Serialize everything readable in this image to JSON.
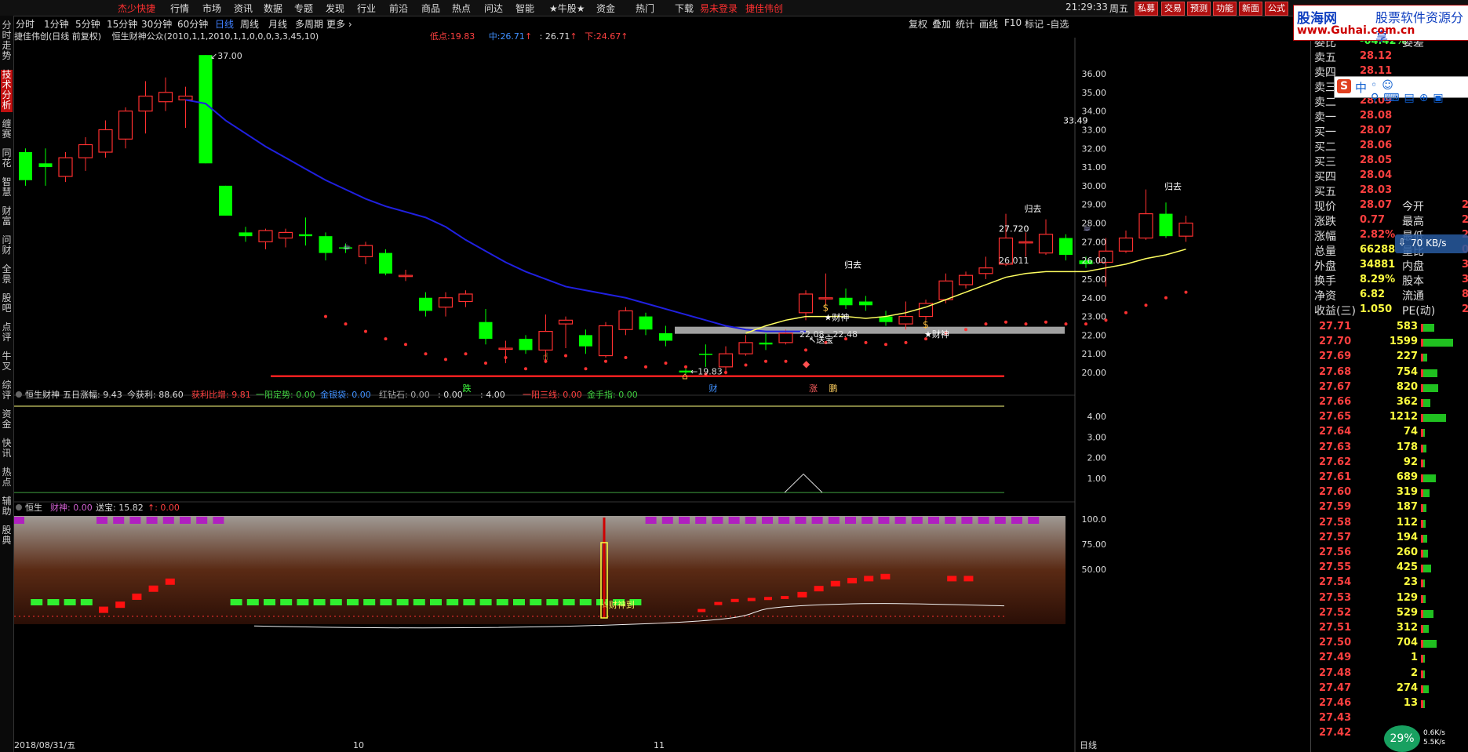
{
  "topbar": {
    "menus": [
      "分时",
      "1分钟",
      "5分钟",
      "15分钟",
      "30分钟",
      "60分钟"
    ],
    "app_name": "杰少快捷",
    "main_menus": [
      "行情",
      "市场",
      "资讯",
      "数据",
      "专题",
      "发现",
      "行业",
      "前沿",
      "商品",
      "热点",
      "问达",
      "智能",
      "★牛股★",
      "资金",
      "热门",
      "下载"
    ],
    "login_status": "易未登录",
    "stock_tag": "捷佳伟创",
    "time": "21:29:33",
    "weekday": "周五",
    "buttons": [
      "私募",
      "交易",
      "预测",
      "功能",
      "新面",
      "公式"
    ]
  },
  "left_tabs": [
    {
      "label": "分时走势",
      "active": false
    },
    {
      "label": "技术分析",
      "active": true
    },
    {
      "label": "缠赛",
      "active": false
    },
    {
      "label": "同花",
      "active": false
    },
    {
      "label": "智慧",
      "active": false
    },
    {
      "label": "财富",
      "active": false
    },
    {
      "label": "问财",
      "active": false
    },
    {
      "label": "全景",
      "active": false
    },
    {
      "label": "股吧",
      "active": false
    },
    {
      "label": "点评",
      "active": false
    },
    {
      "label": "牛叉",
      "active": false
    },
    {
      "label": "综评",
      "active": false
    },
    {
      "label": "资金",
      "active": false
    },
    {
      "label": "快讯",
      "active": false
    },
    {
      "label": "热点",
      "active": false
    },
    {
      "label": "辅助",
      "active": false
    },
    {
      "label": "股典",
      "active": false
    }
  ],
  "period_bar": {
    "periods": [
      "分时",
      "1分钟",
      "5分钟",
      "15分钟",
      "30分钟",
      "60分钟",
      "日线",
      "周线",
      "月线",
      "多周期",
      "更多"
    ],
    "active": "日线",
    "right_tools": [
      "复权",
      "叠加",
      "统计",
      "画线",
      "F10",
      "标记",
      "-自选"
    ]
  },
  "chart_info": {
    "title": "捷佳伟创(日线 前复权)",
    "formula": "恒生财神公众(2010,1,1,2010,1,1,0,0,0,3,3,45,10)",
    "low_label": "低点:",
    "low_value": "19.83",
    "mid_label": "中:",
    "mid_value": "26.71",
    "mid2": ": 26.71",
    "down_label": "下:",
    "down_value": "24.67"
  },
  "main_chart_labels": {
    "max_price": "37.00",
    "min_price": "19.83",
    "range_text": "22.08 - 22.48",
    "right_val1": "27.720",
    "right_val2": "26.011",
    "crosshair_val": "33.49",
    "guiqu": "归去",
    "caishen": "财神",
    "caishen_star": "★财神",
    "songbao": "送宝",
    "die": "跌",
    "cai": "财",
    "zhang": "涨",
    "peng": "鹏"
  },
  "indicator1": {
    "name": "恒生财神",
    "items": [
      "五日涨幅: 9.43",
      "今获利: 88.60",
      "获利比增: 9.81",
      "一阳定势: 0.00",
      "金银袋: 0.00",
      "红钻石: 0.00",
      ": 0.00",
      ": 4.00",
      "一阳三线: 0.00",
      "金手指: 0.00"
    ],
    "item_colors": [
      "#ddd",
      "#ddd",
      "#ff4040",
      "#40d040",
      "#4090ff",
      "#aaa",
      "#ddd",
      "#ddd",
      "#ff4040",
      "#40d040"
    ]
  },
  "indicator2": {
    "name": "恒生",
    "caishen": "财神: 0.00",
    "songbao": "送宝: 15.82",
    "extra": ": 0.00",
    "caishen_dao": "☆财神到"
  },
  "x_axis": {
    "start_date": "2018/08/31/五",
    "ticks": [
      "10",
      "11"
    ],
    "period_label": "日线"
  },
  "chart_data": {
    "type": "candlestick",
    "y_ticks": [
      "36.00",
      "35.00",
      "34.00",
      "33.00",
      "32.00",
      "31.00",
      "30.00",
      "29.00",
      "28.00",
      "27.00",
      "26.00",
      "25.00",
      "24.00",
      "23.00",
      "22.00",
      "21.00",
      "20.00"
    ],
    "ind1_ticks": [
      "4.00",
      "3.00",
      "2.00",
      "1.00"
    ],
    "ind2_ticks": [
      "100.0",
      "75.00",
      "50.00"
    ],
    "candles": [
      {
        "o": 30.3,
        "c": 31.8,
        "h": 32.0,
        "l": 30.0,
        "up": false
      },
      {
        "o": 31.0,
        "c": 31.2,
        "h": 32.0,
        "l": 30.0,
        "up": false
      },
      {
        "o": 30.5,
        "c": 31.5,
        "h": 31.8,
        "l": 30.2,
        "up": true
      },
      {
        "o": 31.5,
        "c": 32.2,
        "h": 32.6,
        "l": 30.8,
        "up": true
      },
      {
        "o": 31.8,
        "c": 33.0,
        "h": 33.5,
        "l": 31.5,
        "up": true
      },
      {
        "o": 32.5,
        "c": 34.0,
        "h": 34.2,
        "l": 32.0,
        "up": true
      },
      {
        "o": 34.0,
        "c": 34.8,
        "h": 35.6,
        "l": 32.8,
        "up": true
      },
      {
        "o": 34.5,
        "c": 35.0,
        "h": 35.8,
        "l": 34.0,
        "up": true
      },
      {
        "o": 34.6,
        "c": 34.8,
        "h": 35.3,
        "l": 33.1,
        "up": true
      },
      {
        "o": 37.0,
        "c": 31.2,
        "h": 37.0,
        "l": 31.2,
        "up": false
      },
      {
        "o": 30.0,
        "c": 28.4,
        "h": 30.0,
        "l": 28.4,
        "up": false
      },
      {
        "o": 27.3,
        "c": 27.5,
        "h": 27.8,
        "l": 27.0,
        "up": false
      },
      {
        "o": 27.0,
        "c": 27.6,
        "h": 27.7,
        "l": 26.6,
        "up": true
      },
      {
        "o": 27.2,
        "c": 27.5,
        "h": 27.7,
        "l": 26.7,
        "up": true
      },
      {
        "o": 27.4,
        "c": 27.3,
        "h": 28.3,
        "l": 26.8,
        "up": false
      },
      {
        "o": 27.3,
        "c": 26.4,
        "h": 27.5,
        "l": 26.0,
        "up": false
      },
      {
        "o": 26.7,
        "c": 26.7,
        "h": 26.9,
        "l": 26.4,
        "up": false
      },
      {
        "o": 26.2,
        "c": 26.8,
        "h": 27.0,
        "l": 25.8,
        "up": true
      },
      {
        "o": 26.4,
        "c": 25.3,
        "h": 26.6,
        "l": 25.2,
        "up": false
      },
      {
        "o": 25.2,
        "c": 25.2,
        "h": 25.5,
        "l": 24.9,
        "up": true
      },
      {
        "o": 24.0,
        "c": 23.3,
        "h": 24.3,
        "l": 23.0,
        "up": false
      },
      {
        "o": 23.5,
        "c": 24.0,
        "h": 24.3,
        "l": 23.0,
        "up": true
      },
      {
        "o": 23.8,
        "c": 24.2,
        "h": 24.4,
        "l": 23.5,
        "up": true
      },
      {
        "o": 22.7,
        "c": 21.8,
        "h": 23.4,
        "l": 21.5,
        "up": false
      },
      {
        "o": 21.3,
        "c": 21.3,
        "h": 21.7,
        "l": 20.5,
        "up": true
      },
      {
        "o": 21.8,
        "c": 21.2,
        "h": 22.0,
        "l": 21.0,
        "up": false
      },
      {
        "o": 21.2,
        "c": 22.2,
        "h": 23.1,
        "l": 20.5,
        "up": true
      },
      {
        "o": 22.6,
        "c": 22.8,
        "h": 23.0,
        "l": 21.3,
        "up": true
      },
      {
        "o": 22.0,
        "c": 21.4,
        "h": 22.3,
        "l": 21.0,
        "up": false
      },
      {
        "o": 20.9,
        "c": 22.5,
        "h": 22.7,
        "l": 20.8,
        "up": true
      },
      {
        "o": 22.3,
        "c": 23.3,
        "h": 23.5,
        "l": 22.0,
        "up": true
      },
      {
        "o": 23.0,
        "c": 22.3,
        "h": 23.2,
        "l": 22.0,
        "up": false
      },
      {
        "o": 22.1,
        "c": 21.7,
        "h": 22.5,
        "l": 21.4,
        "up": false
      },
      {
        "o": 20.1,
        "c": 20.0,
        "h": 20.2,
        "l": 19.9,
        "up": false
      },
      {
        "o": 21.0,
        "c": 21.0,
        "h": 21.5,
        "l": 20.3,
        "up": false
      },
      {
        "o": 20.3,
        "c": 21.0,
        "h": 21.4,
        "l": 19.9,
        "up": true
      },
      {
        "o": 21.0,
        "c": 21.6,
        "h": 22.0,
        "l": 20.9,
        "up": true
      },
      {
        "o": 21.6,
        "c": 21.5,
        "h": 22.1,
        "l": 21.2,
        "up": false
      },
      {
        "o": 21.6,
        "c": 22.1,
        "h": 22.3,
        "l": 21.5,
        "up": true
      },
      {
        "o": 23.2,
        "c": 24.2,
        "h": 24.4,
        "l": 22.8,
        "up": true
      },
      {
        "o": 24.0,
        "c": 24.0,
        "h": 25.3,
        "l": 23.6,
        "up": true
      },
      {
        "o": 24.0,
        "c": 23.6,
        "h": 24.5,
        "l": 23.4,
        "up": false
      },
      {
        "o": 23.8,
        "c": 23.6,
        "h": 24.1,
        "l": 23.3,
        "up": false
      },
      {
        "o": 23.0,
        "c": 22.7,
        "h": 23.3,
        "l": 22.5,
        "up": false
      },
      {
        "o": 23.0,
        "c": 22.6,
        "h": 23.8,
        "l": 22.3,
        "up": true
      },
      {
        "o": 23.0,
        "c": 23.7,
        "h": 23.9,
        "l": 22.8,
        "up": true
      },
      {
        "o": 23.9,
        "c": 24.9,
        "h": 25.3,
        "l": 23.7,
        "up": true
      },
      {
        "o": 24.7,
        "c": 25.2,
        "h": 25.4,
        "l": 24.5,
        "up": true
      },
      {
        "o": 25.3,
        "c": 25.6,
        "h": 26.2,
        "l": 25.0,
        "up": true
      },
      {
        "o": 25.8,
        "c": 27.2,
        "h": 28.5,
        "l": 25.7,
        "up": true
      },
      {
        "o": 27.0,
        "c": 27.0,
        "h": 27.5,
        "l": 26.2,
        "up": true
      },
      {
        "o": 26.4,
        "c": 27.4,
        "h": 28.2,
        "l": 26.3,
        "up": true
      },
      {
        "o": 27.2,
        "c": 26.3,
        "h": 27.4,
        "l": 26.0,
        "up": false
      },
      {
        "o": 26.0,
        "c": 25.8,
        "h": 26.2,
        "l": 25.6,
        "up": false
      },
      {
        "o": 25.9,
        "c": 26.5,
        "h": 27.2,
        "l": 24.6,
        "up": true
      },
      {
        "o": 26.5,
        "c": 27.2,
        "h": 27.6,
        "l": 26.4,
        "up": true
      },
      {
        "o": 27.2,
        "c": 28.5,
        "h": 29.8,
        "l": 27.1,
        "up": true
      },
      {
        "o": 28.5,
        "c": 27.3,
        "h": 29.1,
        "l": 27.2,
        "up": false
      },
      {
        "o": 27.3,
        "c": 28.0,
        "h": 28.4,
        "l": 27.0,
        "up": true
      }
    ],
    "ma_blue": [
      34.6,
      34.4,
      33.5,
      32.8,
      32.1,
      31.5,
      30.9,
      30.3,
      29.8,
      29.3,
      28.9,
      28.6,
      28.3,
      27.8,
      27.1,
      26.5,
      25.9,
      25.4,
      25.0,
      24.6,
      24.4,
      24.2,
      24.0,
      23.7,
      23.4,
      23.1,
      22.8,
      22.5,
      22.3,
      22.2,
      22.2,
      22.2
    ],
    "ma_yellow": [
      22.1,
      22.5,
      22.8,
      23.0,
      23.0,
      23.0,
      22.9,
      23.0,
      23.2,
      23.5,
      23.9,
      24.3,
      24.7,
      25.1,
      25.3,
      25.4,
      25.4,
      25.4,
      25.6,
      25.8,
      26.1,
      26.3,
      26.6
    ]
  },
  "right_panel": {
    "webdiff": "委比",
    "webdiff_val": "-64.42%",
    "webdiff2": "委差",
    "asks": [
      {
        "l": "卖五",
        "v": "28.12"
      },
      {
        "l": "卖四",
        "v": "28.11"
      },
      {
        "l": "卖三",
        "v": "28.10"
      },
      {
        "l": "卖二",
        "v": "28.09"
      },
      {
        "l": "卖一",
        "v": "28.08"
      }
    ],
    "bids": [
      {
        "l": "买一",
        "v": "28.07"
      },
      {
        "l": "买二",
        "v": "28.06"
      },
      {
        "l": "买三",
        "v": "28.05"
      },
      {
        "l": "买四",
        "v": "28.04"
      },
      {
        "l": "买五",
        "v": "28.03"
      }
    ],
    "stats": [
      {
        "l": "现价",
        "v": "28.07",
        "l2": "今开",
        "v2": "27"
      },
      {
        "l": "涨跌",
        "v": "0.77",
        "l2": "最高",
        "v2": "28"
      },
      {
        "l": "涨幅",
        "v": "2.82%",
        "l2": "最低",
        "v2": "27"
      },
      {
        "l": "总量",
        "v": "66288",
        "l2": "量比",
        "v2": "0"
      },
      {
        "l": "外盘",
        "v": "34881",
        "l2": "内盘",
        "v2": "31"
      },
      {
        "l": "换手",
        "v": "8.29%",
        "l2": "股本",
        "v2": "3.2"
      },
      {
        "l": "净资",
        "v": "6.82",
        "l2": "流通",
        "v2": "8000"
      },
      {
        "l": "收益(三)",
        "v": "1.050",
        "l2": "PE(动)",
        "v2": "2"
      }
    ],
    "orderbook": [
      {
        "p": "27.71",
        "v": "583"
      },
      {
        "p": "27.70",
        "v": "1599"
      },
      {
        "p": "27.69",
        "v": "227"
      },
      {
        "p": "27.68",
        "v": "754"
      },
      {
        "p": "27.67",
        "v": "820"
      },
      {
        "p": "27.66",
        "v": "362"
      },
      {
        "p": "27.65",
        "v": "1212"
      },
      {
        "p": "27.64",
        "v": "74"
      },
      {
        "p": "27.63",
        "v": "178"
      },
      {
        "p": "27.62",
        "v": "92"
      },
      {
        "p": "27.61",
        "v": "689"
      },
      {
        "p": "27.60",
        "v": "319"
      },
      {
        "p": "27.59",
        "v": "187"
      },
      {
        "p": "27.58",
        "v": "112"
      },
      {
        "p": "27.57",
        "v": "194"
      },
      {
        "p": "27.56",
        "v": "260"
      },
      {
        "p": "27.55",
        "v": "425"
      },
      {
        "p": "27.54",
        "v": "23"
      },
      {
        "p": "27.53",
        "v": "129"
      },
      {
        "p": "27.52",
        "v": "529"
      },
      {
        "p": "27.51",
        "v": "312"
      },
      {
        "p": "27.50",
        "v": "704"
      },
      {
        "p": "27.49",
        "v": "1"
      },
      {
        "p": "27.48",
        "v": "2"
      },
      {
        "p": "27.47",
        "v": "274"
      },
      {
        "p": "27.46",
        "v": "13"
      },
      {
        "p": "27.43",
        "v": ""
      },
      {
        "p": "27.42",
        "v": ""
      }
    ]
  },
  "overlays": {
    "logo_line1": "股海网",
    "logo_line2": "股票软件资源分享",
    "logo_url": "www.Guhai.com.cn",
    "ime_text": "中",
    "net_speed": "70 KB/s",
    "percent": "29%",
    "small_speed1": "0.6K/s",
    "small_speed2": "5.5K/s"
  },
  "colors": {
    "up": "#ff3030",
    "down": "#00ff00",
    "ma_blue": "#2020e0",
    "ma_yellow": "#ffff60",
    "grid": "#333"
  }
}
